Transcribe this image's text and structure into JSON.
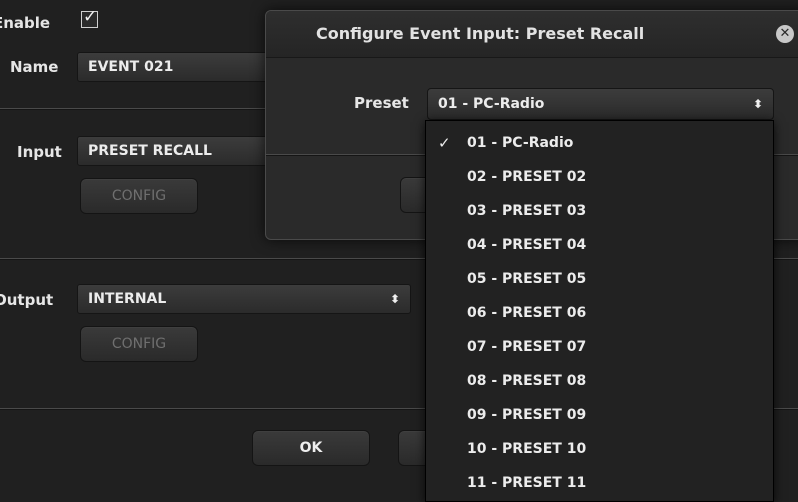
{
  "form": {
    "enable_label": "Enable",
    "enable_checked": true,
    "name_label": "Name",
    "name_value": "EVENT 021",
    "input_label": "Input",
    "input_value": "PRESET RECALL",
    "input_config": "CONFIG",
    "output_label": "Output",
    "output_value": "INTERNAL",
    "output_config": "CONFIG",
    "ok_label": "OK"
  },
  "dialog": {
    "title": "Configure Event Input: Preset Recall",
    "preset_label": "Preset",
    "preset_value": "01 - PC-Radio",
    "options": [
      {
        "label": "01 - PC-Radio",
        "selected": true
      },
      {
        "label": "02 - PRESET 02",
        "selected": false
      },
      {
        "label": "03 - PRESET 03",
        "selected": false
      },
      {
        "label": "04 - PRESET 04",
        "selected": false
      },
      {
        "label": "05 - PRESET 05",
        "selected": false
      },
      {
        "label": "06 - PRESET 06",
        "selected": false
      },
      {
        "label": "07 - PRESET 07",
        "selected": false
      },
      {
        "label": "08 - PRESET 08",
        "selected": false
      },
      {
        "label": "09 - PRESET 09",
        "selected": false
      },
      {
        "label": "10 - PRESET 10",
        "selected": false
      },
      {
        "label": "11 - PRESET 11",
        "selected": false
      }
    ]
  },
  "icons": {
    "checkmark": "checkmark-icon",
    "select_arrows": "select-arrows-icon",
    "close": "close-icon"
  }
}
